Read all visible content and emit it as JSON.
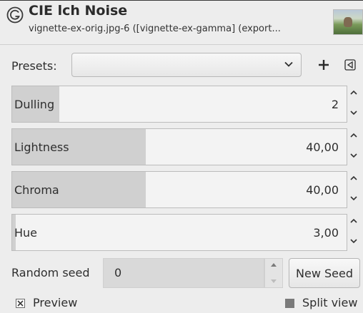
{
  "header": {
    "title": "CIE lch Noise",
    "subtitle": "vignette-ex-orig.jpg-6 ([vignette-ex-gamma] (export..."
  },
  "presets": {
    "label": "Presets:",
    "selected": ""
  },
  "sliders": [
    {
      "label": "Dulling",
      "value": "2",
      "fill_fraction": 0.14
    },
    {
      "label": "Lightness",
      "value": "40,00",
      "fill_fraction": 0.4
    },
    {
      "label": "Chroma",
      "value": "40,00",
      "fill_fraction": 0.4
    },
    {
      "label": "Hue",
      "value": "3,00",
      "fill_fraction": 0.01
    }
  ],
  "seed": {
    "label": "Random seed",
    "value": "0",
    "new_seed_label": "New Seed"
  },
  "preview": {
    "label": "Preview",
    "checked": true
  },
  "split_view": {
    "label": "Split view",
    "checked": false
  }
}
